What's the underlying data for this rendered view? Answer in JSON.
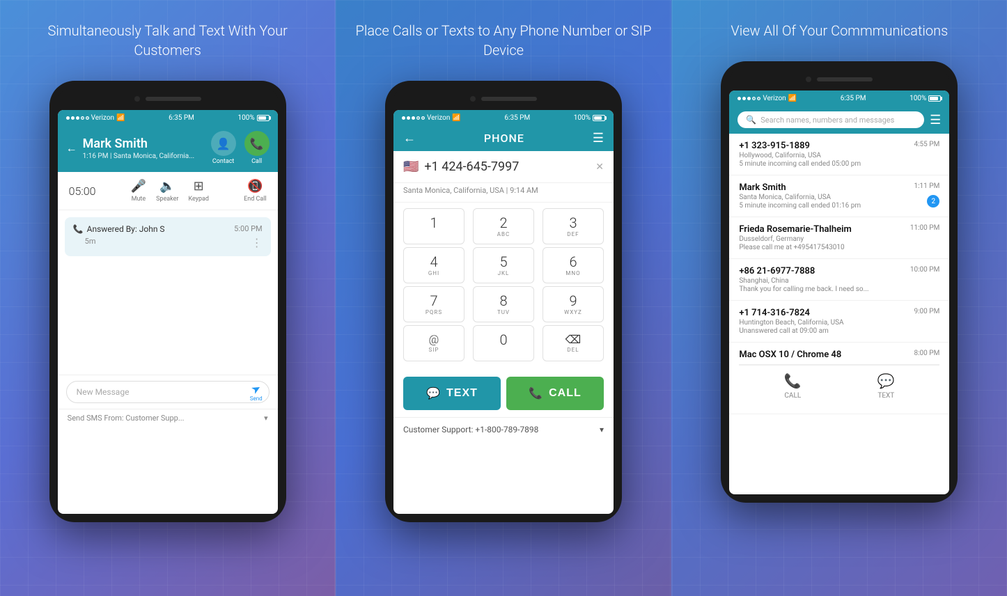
{
  "panels": {
    "left": {
      "title": "Simultaneously Talk and Text With\nYour Customers",
      "phone": {
        "status": {
          "carrier": "Verizon",
          "wifi": "wifi",
          "time": "6:35 PM",
          "battery": "100%"
        },
        "header": {
          "caller_name": "Mark Smith",
          "caller_location": "1:16 PM | Santa Monica, California...",
          "contact_label": "Contact",
          "call_label": "Call"
        },
        "call_controls": {
          "timer": "05:00",
          "mute": "Mute",
          "speaker": "Speaker",
          "keypad": "Keypad",
          "end_call": "End Call"
        },
        "call_log": {
          "answered_by": "Answered By: John S",
          "duration": "5m",
          "time": "5:00 PM"
        },
        "message": {
          "placeholder": "New Message",
          "send_label": "Send",
          "from_label": "Send SMS From: Customer Supp..."
        }
      }
    },
    "middle": {
      "title": "Place Calls or Texts to Any\nPhone Number or SIP Device",
      "phone": {
        "status": {
          "carrier": "Verizon",
          "time": "6:35 PM",
          "battery": "100%"
        },
        "header": {
          "title": "PHONE"
        },
        "dialer": {
          "number": "+1 424-645-7997",
          "location_time": "Santa Monica, California, USA | 9:14 AM",
          "keys": [
            {
              "num": "1",
              "sub": ""
            },
            {
              "num": "2",
              "sub": "ABC"
            },
            {
              "num": "3",
              "sub": "DEF"
            },
            {
              "num": "4",
              "sub": "GHI"
            },
            {
              "num": "5",
              "sub": "JKL"
            },
            {
              "num": "6",
              "sub": "MNO"
            },
            {
              "num": "7",
              "sub": "PQRS"
            },
            {
              "num": "8",
              "sub": "TUV"
            },
            {
              "num": "9",
              "sub": "WXYZ"
            },
            {
              "num": "@",
              "sub": "SIP"
            },
            {
              "num": "0",
              "sub": ""
            },
            {
              "num": "⌫",
              "sub": "DEL"
            }
          ]
        },
        "actions": {
          "text_label": "TEXT",
          "call_label": "CALL"
        },
        "caller_id": "Customer Support: +1-800-789-7898"
      }
    },
    "right": {
      "title": "View All Of Your Commmunications",
      "phone": {
        "status": {
          "carrier": "Verizon",
          "time": "6:35 PM",
          "battery": "100%"
        },
        "search": {
          "placeholder": "Search names, numbers and messages"
        },
        "contacts": [
          {
            "name": "+1 323-915-1889",
            "location": "Hollywood, California, USA",
            "desc": "5 minute incoming call ended 05:00 pm",
            "time": "4:55 PM",
            "badge": null
          },
          {
            "name": "Mark Smith",
            "location": "Santa Monica, California, USA",
            "desc": "5 minute incoming call ended 01:16 pm",
            "time": "1:11 PM",
            "badge": "2"
          },
          {
            "name": "Frieda Rosemarie-Thalheim",
            "location": "Dusseldorf, Germany",
            "desc": "Please call me at +495417543010",
            "time": "11:00 PM",
            "badge": null
          },
          {
            "name": "+86 21-6977-7888",
            "location": "Shanghai, China",
            "desc": "Thank you for calling me back. I need so...",
            "time": "10:00 PM",
            "badge": null
          },
          {
            "name": "+1 714-316-7824",
            "location": "Huntington Beach, California, USA",
            "desc": "Unanswered call at 09:00 am",
            "time": "9:00 PM",
            "badge": null
          },
          {
            "name": "Mac OSX 10 / Chrome 48",
            "location": "",
            "desc": "",
            "time": "8:00 PM",
            "badge": null
          }
        ],
        "footer": {
          "call_label": "CALL",
          "text_label": "TEXT"
        }
      }
    }
  }
}
